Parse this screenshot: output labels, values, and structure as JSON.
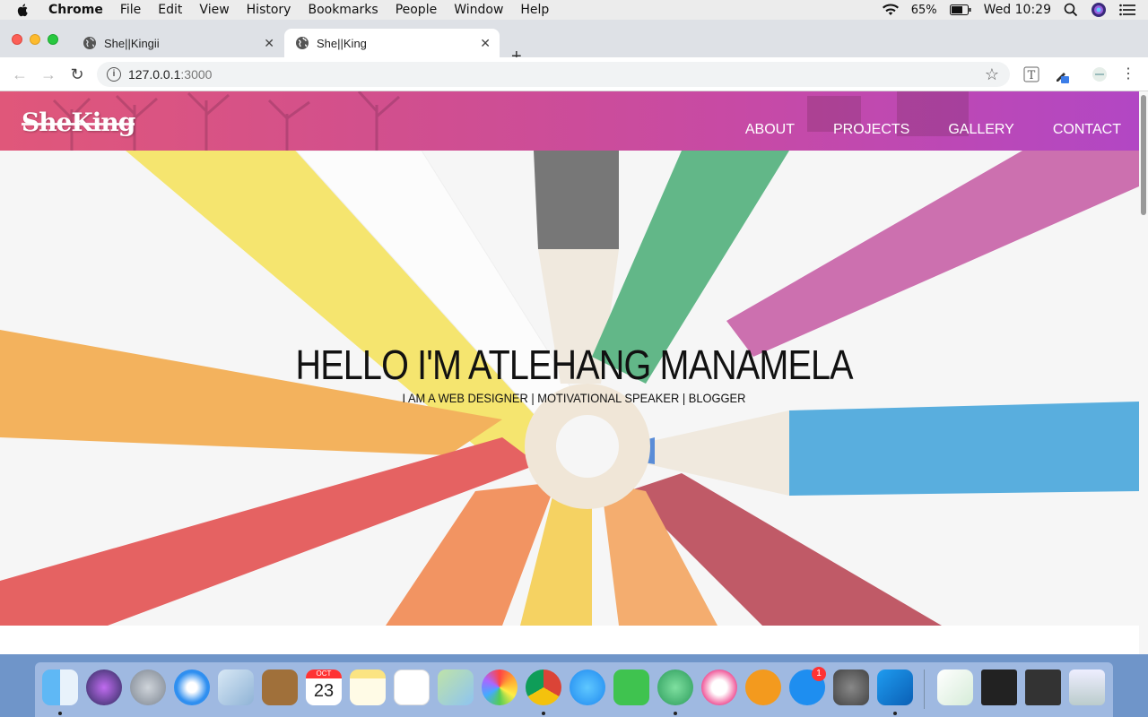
{
  "menubar": {
    "app": "Chrome",
    "items": [
      "File",
      "Edit",
      "View",
      "History",
      "Bookmarks",
      "People",
      "Window",
      "Help"
    ],
    "battery": "65%",
    "clock": "Wed 10:29"
  },
  "tabs": [
    {
      "title": "She||Kingii",
      "active": false
    },
    {
      "title": "She||King",
      "active": true
    }
  ],
  "address": {
    "host": "127.0.0.1",
    "port": ":3000"
  },
  "site": {
    "logo": "SheKing",
    "nav": [
      "ABOUT",
      "PROJECTS",
      "GALLERY",
      "CONTACT"
    ],
    "hero_title": "HELLO I'M ATLEHANG MANAMELA",
    "hero_subtitle": "I AM A WEB DESIGNER | MOTIVATIONAL SPEAKER | BLOGGER"
  },
  "dock": {
    "apps": [
      "finder-icon",
      "siri-icon",
      "launchpad-icon",
      "safari-icon",
      "mail-icon",
      "contacts-icon",
      "calendar-icon",
      "notes-icon",
      "reminders-icon",
      "maps-icon",
      "photos-icon",
      "chrome-icon",
      "messages-icon",
      "facetime-icon",
      "atom-icon",
      "itunes-icon",
      "books-icon",
      "app-store-icon",
      "system-preferences-icon",
      "vscode-icon",
      "preview-icon",
      "terminal-icon",
      "terminal-2-icon",
      "trash-icon"
    ],
    "calendar_month": "OCT",
    "calendar_day": "23",
    "app_store_badge": "1"
  }
}
